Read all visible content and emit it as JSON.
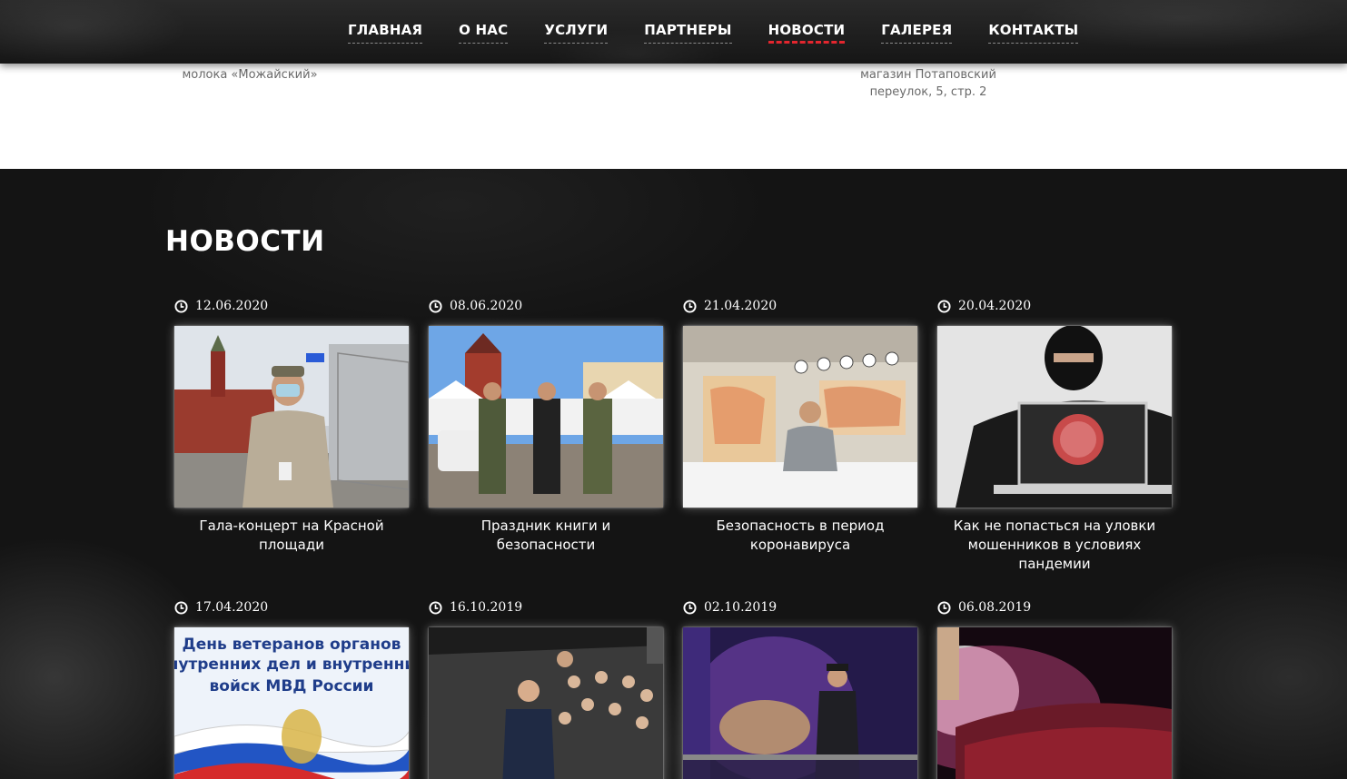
{
  "nav": {
    "items": [
      {
        "label": "ГЛАВНАЯ"
      },
      {
        "label": "О НАС"
      },
      {
        "label": "УСЛУГИ"
      },
      {
        "label": "ПАРТНЕРЫ"
      },
      {
        "label": "НОВОСТИ",
        "active": true
      },
      {
        "label": "ГАЛЕРЕЯ"
      },
      {
        "label": "КОНТАКТЫ"
      }
    ],
    "active_color": "#e3262e"
  },
  "partners": {
    "caption_left": "молока «Можайский»",
    "caption_right_line1": "магазин Потаповский",
    "caption_right_line2": "переулок, 5, стр. 2"
  },
  "news": {
    "title": "НОВОСТИ",
    "items": [
      {
        "date": "12.06.2020",
        "title": "Гала-концерт на Красной площади",
        "icon": "clock-icon"
      },
      {
        "date": "08.06.2020",
        "title": "Праздник книги и безопасности",
        "icon": "clock-icon"
      },
      {
        "date": "21.04.2020",
        "title": "Безопасность в период коронавируса",
        "icon": "clock-icon"
      },
      {
        "date": "20.04.2020",
        "title": "Как не попасться на уловки мошенников в условиях пандемии",
        "icon": "clock-icon"
      },
      {
        "date": "17.04.2020",
        "title": "",
        "icon": "clock-icon",
        "image_text_line1": "День ветеранов органов",
        "image_text_line2": "внутренних дел и внутренних",
        "image_text_line3": "войск МВД России"
      },
      {
        "date": "16.10.2019",
        "title": "",
        "icon": "clock-icon"
      },
      {
        "date": "02.10.2019",
        "title": "",
        "icon": "clock-icon"
      },
      {
        "date": "06.08.2019",
        "title": "",
        "icon": "clock-icon"
      }
    ]
  }
}
